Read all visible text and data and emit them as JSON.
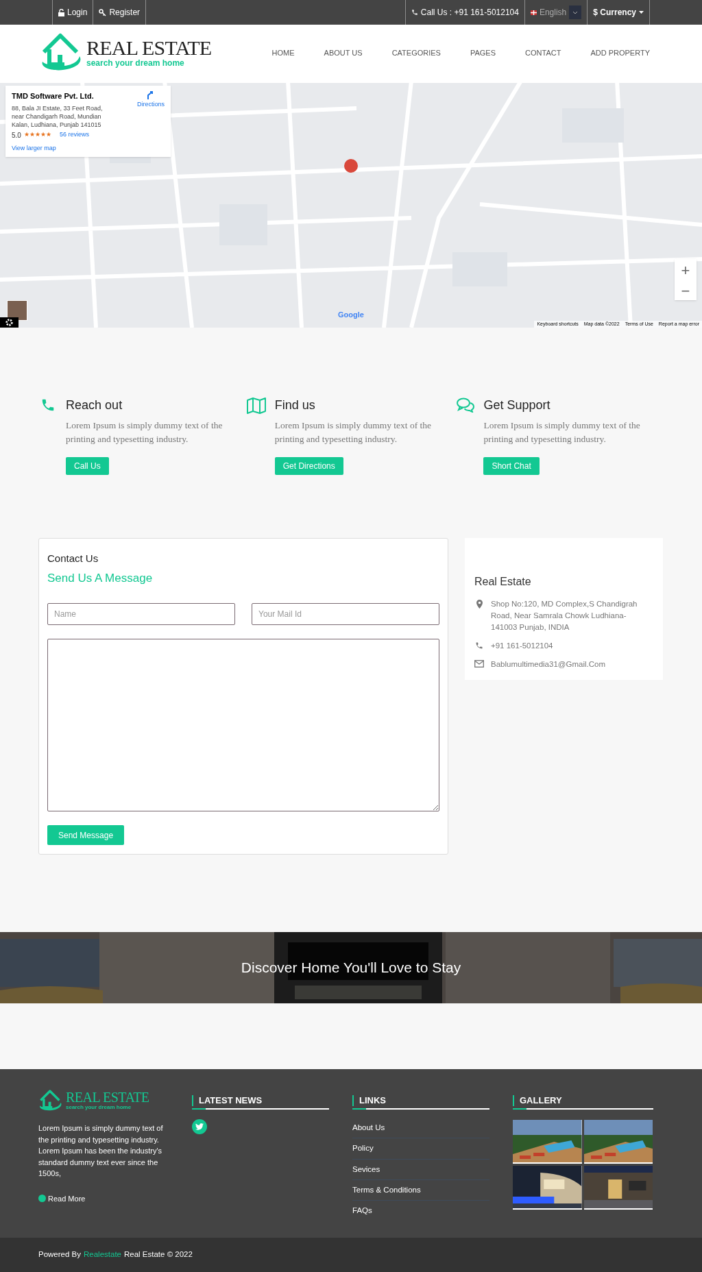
{
  "top_bar": {
    "left": [
      {
        "kind": "login",
        "label": "Login"
      },
      {
        "kind": "register",
        "label": "Register"
      }
    ],
    "call": "Call Us : +91 161-5012104",
    "language": "English",
    "currency": "$ Currency"
  },
  "header": {
    "logo": {
      "title": "REAL ESTATE",
      "tagline": "search your dream home"
    },
    "nav": [
      "HOME",
      "ABOUT US",
      "CATEGORIES",
      "PAGES",
      "CONTACT",
      "ADD PROPERTY"
    ]
  },
  "map": {
    "kind": "picture",
    "info": {
      "name": "TMD Software Pvt. Ltd.",
      "address": "88, Bala JI Estate, 33 Feet Road, near Chandigarh Road, Mundian Kalan, Ludhiana, Punjab 141015",
      "rating": "5.0",
      "stars": 5,
      "reviews": "56 reviews",
      "directions": "Directions",
      "larger": "View larger map"
    },
    "zoom_in": "+",
    "zoom_out": "−",
    "brand": "Google",
    "footer": [
      "Keyboard shortcuts",
      "Map data ©2022",
      "Terms of Use",
      "Report a map error"
    ]
  },
  "features": [
    {
      "kind": "phone",
      "title": "Reach out",
      "text": "Lorem Ipsum is simply dummy text of the printing and typesetting industry.",
      "button": "Call Us"
    },
    {
      "kind": "map",
      "title": "Find us",
      "text": "Lorem Ipsum is simply dummy text of the printing and typesetting industry.",
      "button": "Get Directions"
    },
    {
      "kind": "chat",
      "title": "Get Support",
      "text": "Lorem Ipsum is simply dummy text of the printing and typesetting industry.",
      "button": "Short Chat"
    }
  ],
  "contact_form": {
    "eyebrow": "Contact Us",
    "title": "Send Us A Message",
    "fields": [
      {
        "placeholder": "Name"
      },
      {
        "placeholder": "Your Mail Id"
      }
    ],
    "button": "Send Message"
  },
  "contact_info": {
    "title": "Real Estate",
    "items": [
      {
        "kind": "address",
        "text": "Shop No:120, MD Complex,S Chandigrah Road, Near Samrala Chowk Ludhiana-141003 Punjab, INDIA"
      },
      {
        "kind": "phone",
        "text": "+91 161-5012104"
      },
      {
        "kind": "email",
        "text": "Bablumultimedia31@Gmail.Com"
      }
    ]
  },
  "banner": {
    "kind": "picture",
    "title": "Discover Home You'll Love to Stay"
  },
  "footer": {
    "logo": {
      "title": "REAL ESTATE",
      "tagline": "search your dream home"
    },
    "about": "Lorem Ipsum is simply dummy text of the printing and typesetting industry. Lorem Ipsum has been the industry's standard dummy text ever since the 1500s,",
    "read_more": "Read More",
    "news_title": "LATEST NEWS",
    "links_title": "LINKS",
    "links": [
      "About Us",
      "Policy",
      "Sevices",
      "Terms & Conditions",
      "FAQs"
    ],
    "gallery_title": "GALLERY",
    "gallery": [
      {
        "kind": "pool"
      },
      {
        "kind": "pool"
      },
      {
        "kind": "night"
      },
      {
        "kind": "entrance"
      }
    ]
  },
  "copyright": {
    "prefix": "Powered By",
    "link": "Realestate",
    "suffix": "Real Estate © 2022"
  }
}
